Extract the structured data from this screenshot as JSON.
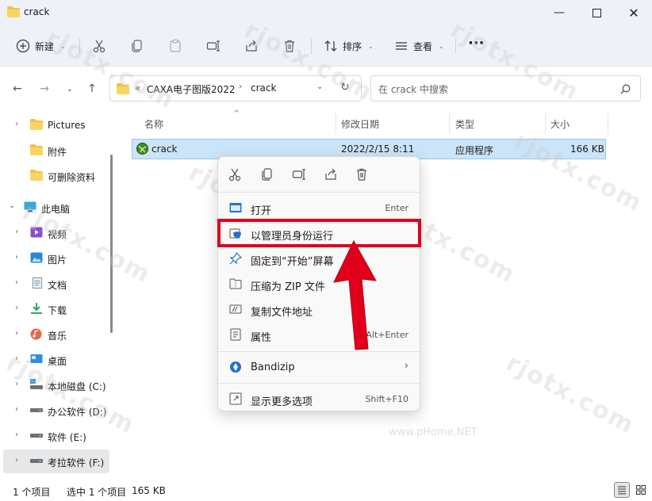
{
  "window": {
    "title": "crack",
    "icon": "folder-icon"
  },
  "toolbar": {
    "new_label": "新建",
    "sort_label": "排序",
    "view_label": "查看",
    "more_label": "···"
  },
  "address": {
    "path_prefix": "«",
    "segments": [
      "CAXA电子图版2022",
      "crack"
    ],
    "search_placeholder": "在 crack 中搜索"
  },
  "sidebar": {
    "items": [
      {
        "label": "Pictures",
        "icon": "folder-icon"
      },
      {
        "label": "附件",
        "icon": "folder-icon"
      },
      {
        "label": "可删除资料",
        "icon": "folder-icon"
      },
      {
        "label": "此电脑",
        "icon": "pc-icon"
      },
      {
        "label": "视频",
        "icon": "video-icon"
      },
      {
        "label": "图片",
        "icon": "pictures-icon"
      },
      {
        "label": "文档",
        "icon": "documents-icon"
      },
      {
        "label": "下载",
        "icon": "download-icon"
      },
      {
        "label": "音乐",
        "icon": "music-icon"
      },
      {
        "label": "桌面",
        "icon": "desktop-icon"
      },
      {
        "label": "本地磁盘 (C:)",
        "icon": "drive-icon"
      },
      {
        "label": "办公软件 (D:)",
        "icon": "drive-icon"
      },
      {
        "label": "软件 (E:)",
        "icon": "drive-icon"
      },
      {
        "label": "考拉软件 (F:)",
        "icon": "drive-icon"
      }
    ]
  },
  "filelist": {
    "columns": [
      "名称",
      "修改日期",
      "类型",
      "大小"
    ],
    "rows": [
      {
        "name": "crack",
        "modified": "2022/2/15 8:11",
        "type": "应用程序",
        "size": "166 KB"
      }
    ]
  },
  "context_menu": {
    "items": [
      {
        "label": "打开",
        "shortcut": "Enter",
        "icon": "open-icon"
      },
      {
        "label": "以管理员身份运行",
        "shortcut": "",
        "icon": "admin-shield-icon"
      },
      {
        "label": "固定到“开始”屏幕",
        "shortcut": "",
        "icon": "pin-icon"
      },
      {
        "label": "压缩为 ZIP 文件",
        "shortcut": "",
        "icon": "zip-icon"
      },
      {
        "label": "复制文件地址",
        "shortcut": "",
        "icon": "copy-path-icon"
      },
      {
        "label": "属性",
        "shortcut": "Alt+Enter",
        "icon": "properties-icon"
      },
      {
        "label": "Bandizip",
        "shortcut": "",
        "icon": "bandizip-icon"
      },
      {
        "label": "显示更多选项",
        "shortcut": "Shift+F10",
        "icon": "more-options-icon"
      }
    ]
  },
  "statusbar": {
    "count": "1 个项目",
    "selected": "选中 1 个项目",
    "size": "165 KB"
  },
  "watermark": {
    "text": "rjotx.com",
    "text2": "www.pHome.NET"
  },
  "colors": {
    "accent": "#0067c0",
    "selection": "#cce4f7",
    "highlight_box": "#e0001b",
    "arrow": "#e0001b",
    "folder": "#f3c141"
  }
}
